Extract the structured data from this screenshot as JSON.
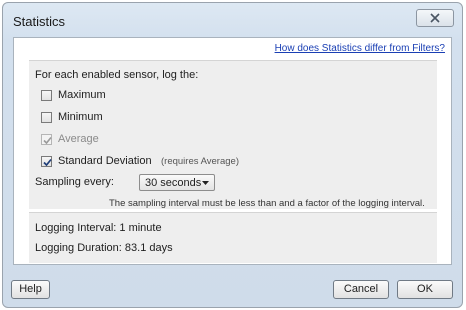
{
  "window": {
    "title": "Statistics",
    "close_icon": "close-x-icon"
  },
  "help_link": "How does Statistics differ from Filters?",
  "log_section": {
    "heading": "For each enabled sensor, log the:",
    "options": [
      {
        "label": "Maximum",
        "checked": false,
        "enabled": true
      },
      {
        "label": "Minimum",
        "checked": false,
        "enabled": true
      },
      {
        "label": "Average",
        "checked": true,
        "enabled": false
      },
      {
        "label": "Standard Deviation",
        "checked": true,
        "enabled": true,
        "note": "(requires Average)"
      }
    ]
  },
  "sampling": {
    "label": "Sampling every:",
    "selected": "30 seconds",
    "hint": "The sampling interval must be less than and a factor of the logging interval."
  },
  "info": {
    "logging_interval": "Logging Interval: 1 minute",
    "logging_duration": "Logging Duration: 83.1 days"
  },
  "buttons": {
    "help": "Help",
    "cancel": "Cancel",
    "ok": "OK"
  }
}
